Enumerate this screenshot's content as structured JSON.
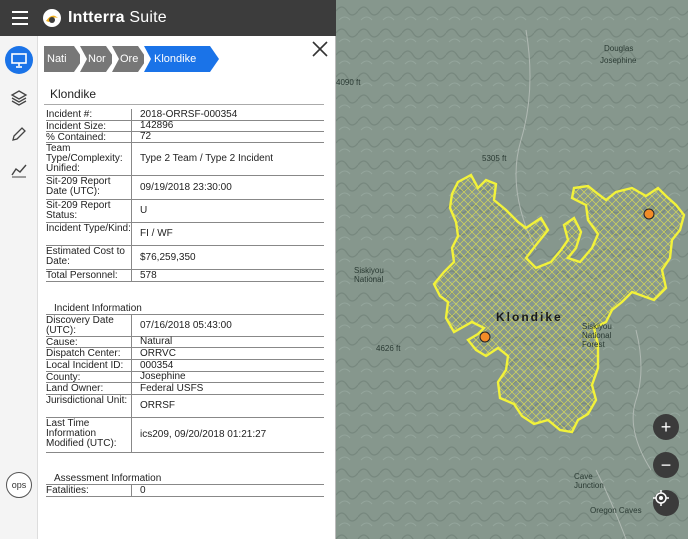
{
  "app": {
    "title_bold": "Intterra",
    "title_rest": " Suite"
  },
  "rail": {
    "ops_label": "ops"
  },
  "breadcrumbs": [
    {
      "label": "Nati"
    },
    {
      "label": "Nor"
    },
    {
      "label": "Ore"
    },
    {
      "label": "Klondike"
    }
  ],
  "incident": {
    "name": "Klondike",
    "details": [
      {
        "key": "Incident #:",
        "value": "2018-ORRSF-000354"
      },
      {
        "key": "Incident Size:",
        "value": "142896"
      },
      {
        "key": "% Contained:",
        "value": "72"
      },
      {
        "key": "Team Type/Complexity: Unified:",
        "value": "Type 2 Team / Type 2 Incident"
      },
      {
        "key": "Sit-209 Report Date (UTC):",
        "value": "09/19/2018 23:30:00"
      },
      {
        "key": "Sit-209 Report Status:",
        "value": "U"
      },
      {
        "key": "Incident Type/Kind:",
        "value": "FI / WF"
      },
      {
        "key": "Estimated Cost to Date:",
        "value": "$76,259,350"
      },
      {
        "key": "Total Personnel:",
        "value": "578"
      }
    ],
    "info_title": "Incident Information",
    "info": [
      {
        "key": "Discovery Date (UTC):",
        "value": "07/16/2018 05:43:00"
      },
      {
        "key": "Cause:",
        "value": "Natural"
      },
      {
        "key": "Dispatch Center:",
        "value": "ORRVC"
      },
      {
        "key": "Local Incident ID:",
        "value": "000354"
      },
      {
        "key": "County:",
        "value": "Josephine"
      },
      {
        "key": "Land Owner:",
        "value": "Federal USFS"
      },
      {
        "key": "Jurisdictional Unit:",
        "value": "ORRSF"
      },
      {
        "key": "Last Time Information Modified (UTC):",
        "value": "ics209, 09/20/2018 01:21:27"
      }
    ],
    "assessment_title": "Assessment Information",
    "assessment": [
      {
        "key": "Fatalities:",
        "value": "0"
      }
    ]
  },
  "map": {
    "fire_label": "Klondike",
    "labels": {
      "douglas": "Douglas",
      "josephine": "Josephine",
      "elev1": "4090 ft",
      "elev2": "5305 ft",
      "elev3": "4626 ft",
      "siskiyou": "Siskiyou National",
      "siskiyou2": "Siskiyou National Forest",
      "cave": "Cave Junction",
      "oregon": "Oregon Caves"
    },
    "zoom_in": "+",
    "zoom_out": "−",
    "perimeter_color": "#f2f23a",
    "point_color": "#f28c28"
  }
}
